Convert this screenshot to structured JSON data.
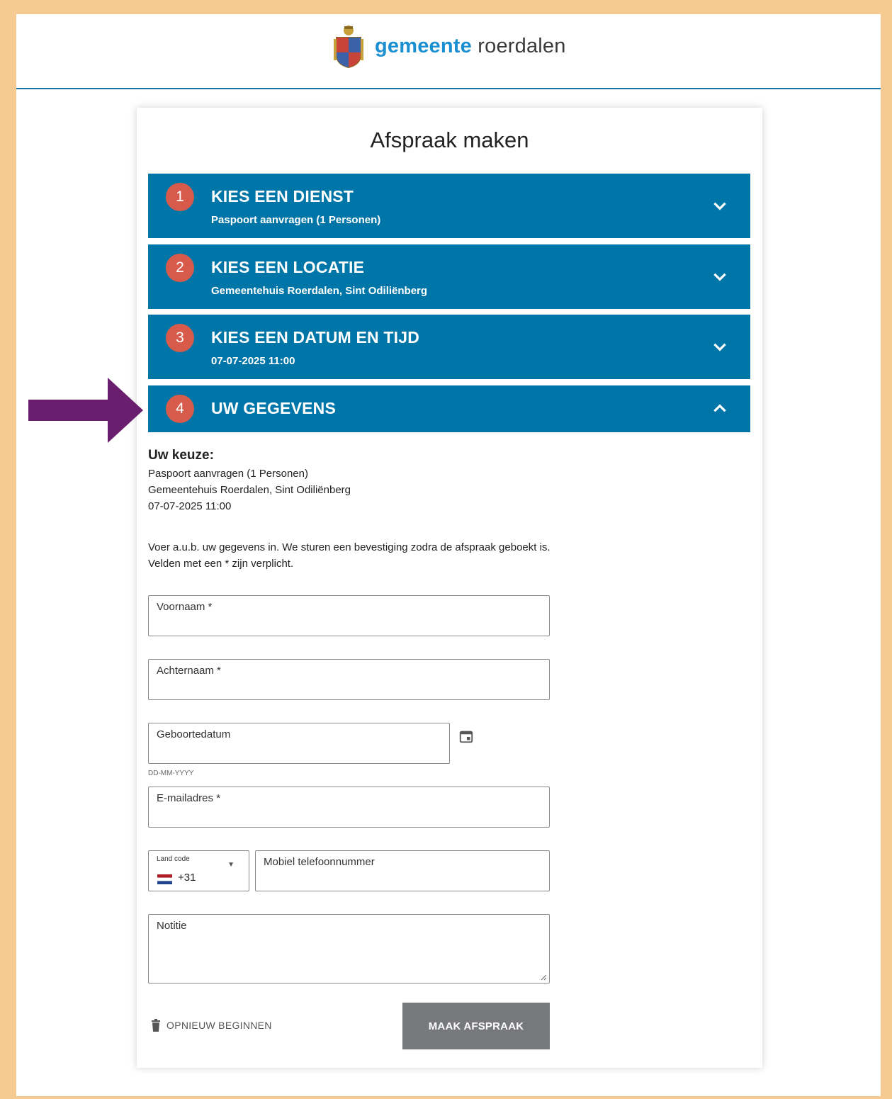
{
  "brand": {
    "name_bold": "gemeente",
    "name_light": " roerdalen"
  },
  "page": {
    "title": "Afspraak maken"
  },
  "steps": [
    {
      "number": "1",
      "title": "KIES EEN DIENST",
      "subtitle": "Paspoort aanvragen (1 Personen)",
      "state": "collapsed"
    },
    {
      "number": "2",
      "title": "KIES EEN LOCATIE",
      "subtitle": "Gemeentehuis Roerdalen, Sint Odiliënberg",
      "state": "collapsed"
    },
    {
      "number": "3",
      "title": "KIES EEN DATUM EN TIJD",
      "subtitle": "07-07-2025 11:00",
      "state": "collapsed"
    },
    {
      "number": "4",
      "title": "UW GEGEVENS",
      "state": "expanded"
    }
  ],
  "choice": {
    "heading": "Uw keuze:",
    "service": "Paspoort aanvragen (1 Personen)",
    "location": "Gemeentehuis Roerdalen, Sint Odiliënberg",
    "datetime": "07-07-2025 11:00"
  },
  "intro": {
    "line1": "Voer a.u.b. uw gegevens in. We sturen een bevestiging zodra de afspraak geboekt is.",
    "line2": "Velden met een * zijn verplicht."
  },
  "form": {
    "voornaam_label": "Voornaam *",
    "achternaam_label": "Achternaam *",
    "geboortedatum_label": "Geboortedatum",
    "geboortedatum_hint": "DD-MM-YYYY",
    "email_label": "E-mailadres *",
    "landcode_label": "Land code",
    "landcode_value": "+31",
    "mobiel_label": "Mobiel telefoonnummer",
    "notitie_label": "Notitie"
  },
  "actions": {
    "restart_label": "OPNIEUW BEGINNEN",
    "submit_label": "MAAK AFSPRAAK"
  },
  "colors": {
    "accent": "#0076a8",
    "step_badge": "#d85a4b",
    "frame": "#f5cb93",
    "arrow": "#6a1e6e",
    "submit": "#76787b"
  }
}
